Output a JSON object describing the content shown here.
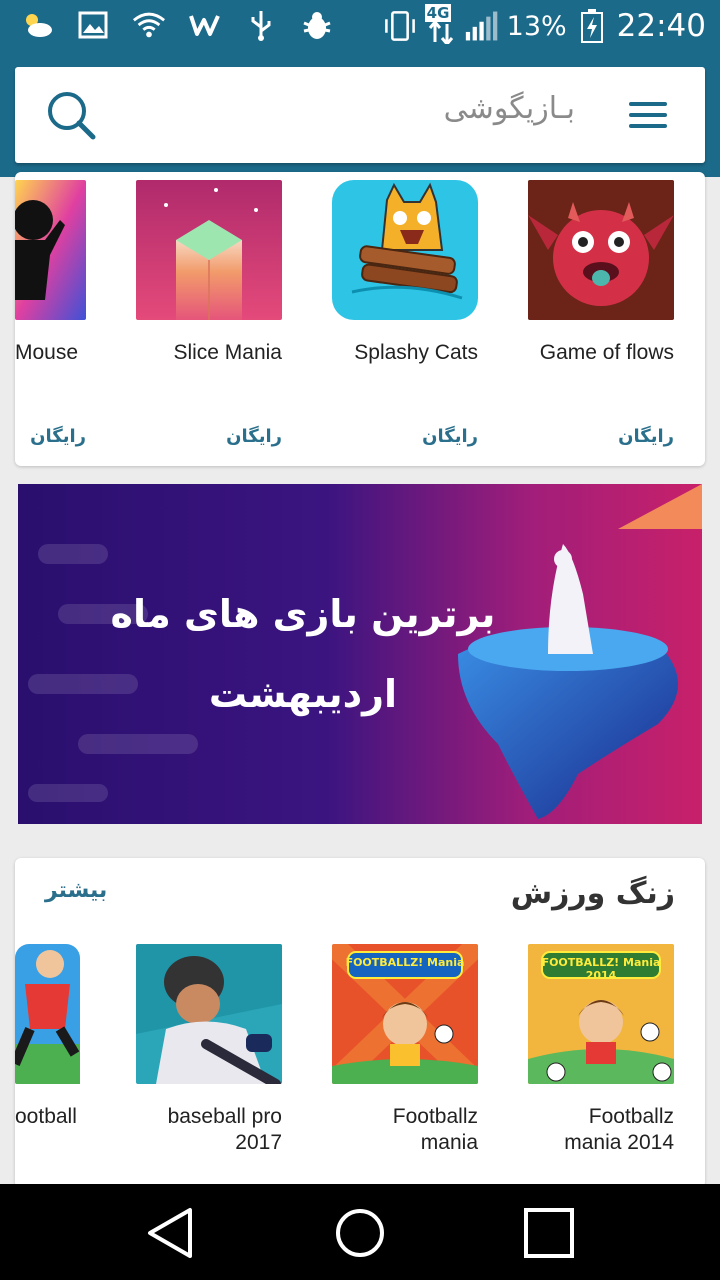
{
  "status_bar": {
    "battery_percent": "13%",
    "time": "22:40",
    "network": "4G",
    "icons_left": [
      "weather-icon",
      "gallery-icon",
      "wifi-icon",
      "w-app-icon",
      "usb-icon",
      "bug-icon"
    ],
    "icons_right": [
      "vibrate-icon",
      "data-arrows-icon",
      "signal-icon",
      "battery-charging-icon"
    ]
  },
  "header": {
    "title": "بـازیگوشی",
    "color": "#1c6a8a"
  },
  "top_apps": [
    {
      "name": "Game of flows",
      "price": "رایگان"
    },
    {
      "name": "Splashy Cats",
      "price": "رایگان"
    },
    {
      "name": "Slice Mania",
      "price": "رایگان"
    },
    {
      "name": "Mouse",
      "price": "رایگان"
    }
  ],
  "banner": {
    "line1": "برترین بازی های ماه",
    "line2": "اردیبهشت"
  },
  "sports_section": {
    "title": "زنگ ورزش",
    "more": "بیشتر",
    "apps": [
      {
        "name": "Footballz mania 2014",
        "logo_text": "FOOTBALLZ! Mania 2014"
      },
      {
        "name": "Footballz mania",
        "logo_text": "FOOTBALLZ! Mania"
      },
      {
        "name": "baseball pro 2017",
        "logo_text": ""
      },
      {
        "name": "ootball",
        "logo_text": ""
      }
    ]
  },
  "nav": [
    "back-icon",
    "home-icon",
    "recents-icon"
  ]
}
